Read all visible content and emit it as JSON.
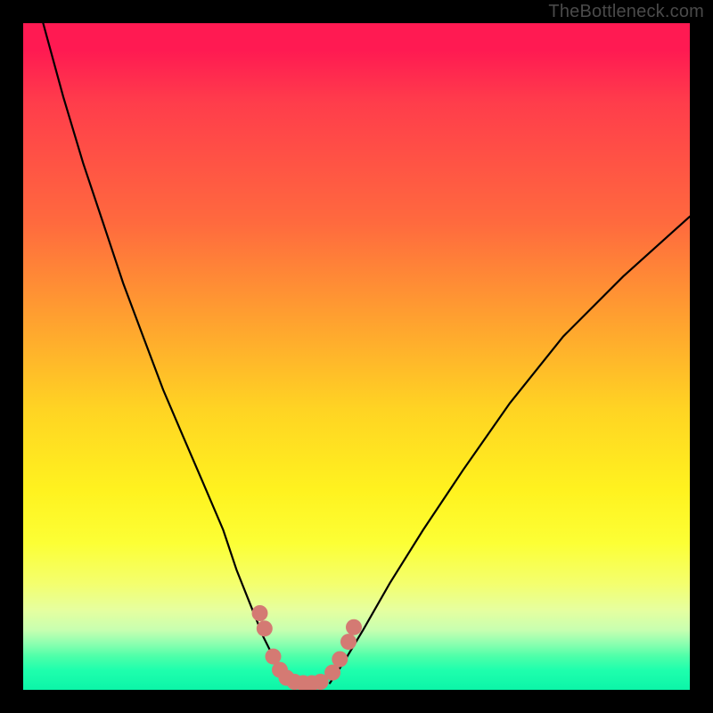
{
  "watermark": {
    "text": "TheBottleneck.com"
  },
  "colors": {
    "background": "#000000",
    "curve_stroke": "#000000",
    "marker_fill": "#d47a73",
    "gradient_top": "#ff1a52",
    "gradient_bottom": "#0cf5a8"
  },
  "chart_data": {
    "type": "line",
    "title": "",
    "xlabel": "",
    "ylabel": "",
    "xlim": [
      0,
      100
    ],
    "ylim": [
      0,
      100
    ],
    "grid": false,
    "series": [
      {
        "name": "left-curve",
        "x": [
          3,
          6,
          9,
          12,
          15,
          18,
          21,
          24,
          27,
          30,
          32,
          34,
          36,
          38,
          40
        ],
        "y": [
          100,
          89,
          79,
          70,
          61,
          53,
          45,
          38,
          31,
          24,
          18,
          13,
          8,
          4,
          1
        ]
      },
      {
        "name": "right-curve",
        "x": [
          46,
          48,
          51,
          55,
          60,
          66,
          73,
          81,
          90,
          100
        ],
        "y": [
          1,
          4,
          9,
          16,
          24,
          33,
          43,
          53,
          62,
          71
        ]
      }
    ],
    "annotations": {
      "markers": [
        {
          "x": 35.5,
          "y": 11.5
        },
        {
          "x": 36.2,
          "y": 9.2
        },
        {
          "x": 37.5,
          "y": 5.0
        },
        {
          "x": 38.5,
          "y": 3.0
        },
        {
          "x": 39.5,
          "y": 1.8
        },
        {
          "x": 40.7,
          "y": 1.2
        },
        {
          "x": 42.0,
          "y": 1.0
        },
        {
          "x": 43.3,
          "y": 1.0
        },
        {
          "x": 44.6,
          "y": 1.2
        },
        {
          "x": 46.4,
          "y": 2.6
        },
        {
          "x": 47.5,
          "y": 4.6
        },
        {
          "x": 48.8,
          "y": 7.2
        },
        {
          "x": 49.6,
          "y": 9.4
        }
      ]
    }
  }
}
